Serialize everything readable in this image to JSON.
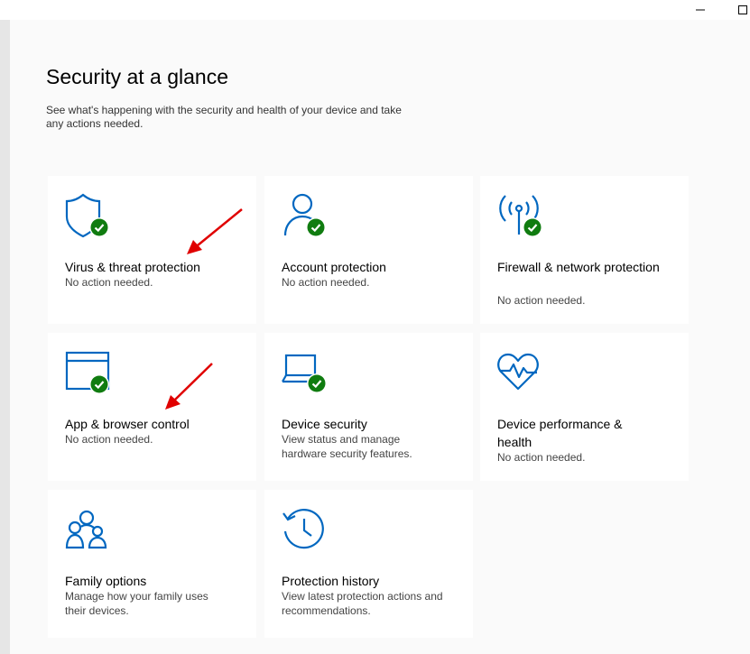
{
  "page": {
    "title": "Security at a glance",
    "description": "See what's happening with the security and health of your device and take any actions needed."
  },
  "window_controls": [
    "minimize-icon",
    "maximize-icon"
  ],
  "tiles": [
    {
      "title": "Virus & threat protection",
      "status": "No action needed.",
      "icon": "shield-icon",
      "ok": true
    },
    {
      "title": "Account protection",
      "status": "No action needed.",
      "icon": "person-icon",
      "ok": true
    },
    {
      "title": "Firewall & network protection",
      "status": "No action needed.",
      "icon": "wifi-antenna-icon",
      "ok": true
    },
    {
      "title": "App & browser control",
      "status": "No action needed.",
      "icon": "browser-window-icon",
      "ok": true
    },
    {
      "title": "Device security",
      "status": "View status and manage hardware security features.",
      "icon": "laptop-icon",
      "ok": true
    },
    {
      "title": "Device performance & health",
      "status": "No action needed.",
      "icon": "heart-pulse-icon",
      "ok": false
    },
    {
      "title": "Family options",
      "status": "Manage how your family uses their devices.",
      "icon": "family-icon",
      "ok": false
    },
    {
      "title": "Protection history",
      "status": "View latest protection actions and recommendations.",
      "icon": "history-clock-icon",
      "ok": false
    }
  ],
  "annotations": [
    "red-arrow-icon",
    "red-arrow-icon"
  ],
  "colors": {
    "accent": "#0067c0",
    "ok_badge": "#107c10",
    "annotation": "#e00000",
    "tile_bg": "#ffffff",
    "page_bg": "#fafafa"
  }
}
